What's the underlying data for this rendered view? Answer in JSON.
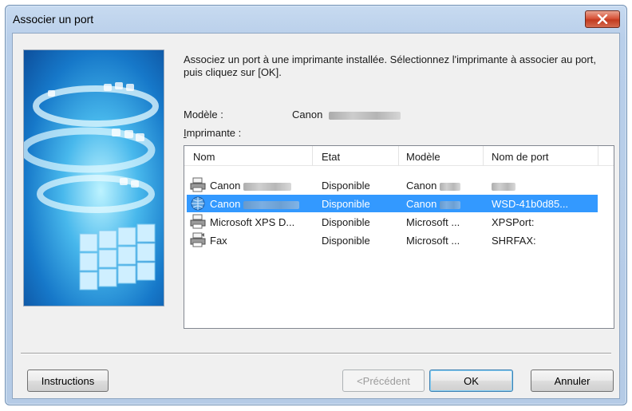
{
  "window": {
    "title": "Associer un port"
  },
  "instructions_text": "Associez un port à une imprimante installée. Sélectionnez l'imprimante à associer au port, puis cliquez sur [OK].",
  "model": {
    "label": "Modèle :",
    "value_prefix": "Canon"
  },
  "printer": {
    "label_underlined": "I",
    "label_rest": "mprimante :"
  },
  "list": {
    "columns": [
      "Nom",
      "Etat",
      "Modèle",
      "Nom de port"
    ],
    "rows": [
      {
        "name": "Canon",
        "state": "Disponible",
        "model": "Canon",
        "port": "",
        "selected": false,
        "icon": "printer-icon"
      },
      {
        "name": "Canon",
        "state": "Disponible",
        "model": "Canon",
        "port": "WSD-41b0d85...",
        "selected": true,
        "icon": "network-printer-icon"
      },
      {
        "name": "Microsoft XPS D...",
        "state": "Disponible",
        "model": "Microsoft ...",
        "port": "XPSPort:",
        "selected": false,
        "icon": "printer-icon"
      },
      {
        "name": "Fax",
        "state": "Disponible",
        "model": "Microsoft ...",
        "port": "SHRFAX:",
        "selected": false,
        "icon": "fax-icon"
      }
    ]
  },
  "buttons": {
    "instructions": "Instructions",
    "previous": "<Précédent",
    "ok": "OK",
    "cancel": "Annuler"
  },
  "colors": {
    "selection": "#3399ff",
    "close": "#c23a1f"
  }
}
